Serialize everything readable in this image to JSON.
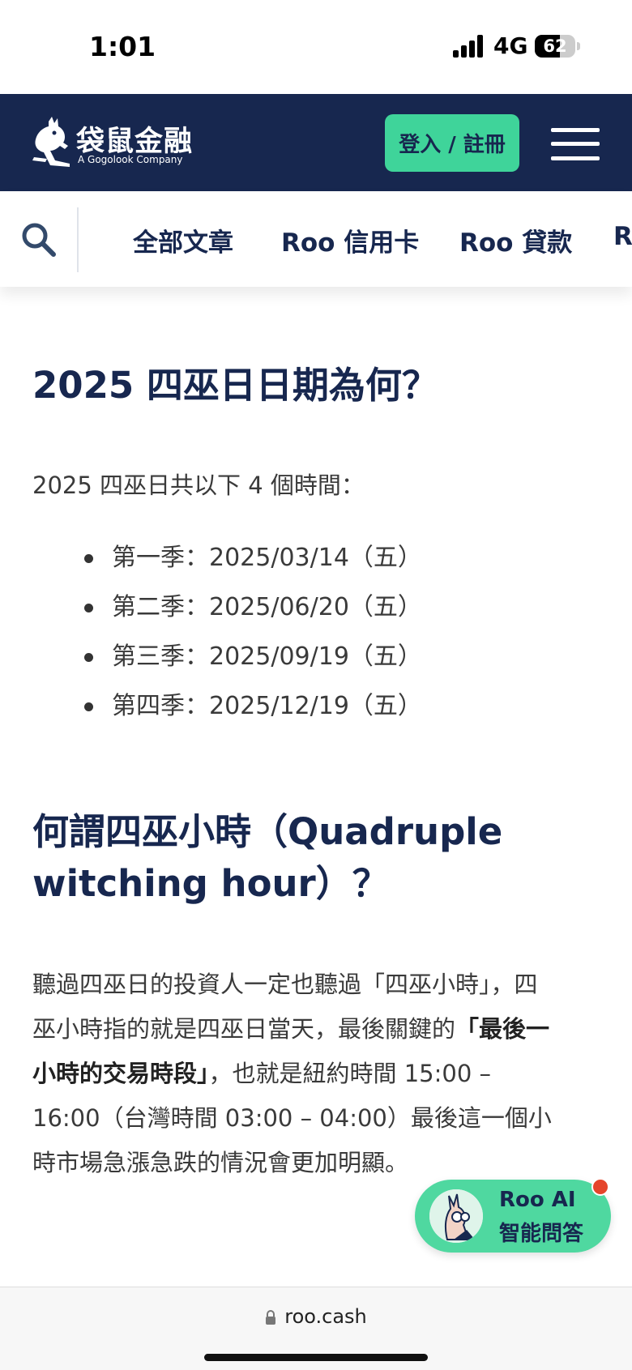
{
  "status_bar": {
    "time": "1:01",
    "network": "4G",
    "battery": "62",
    "battery_level": 0.62
  },
  "header": {
    "logo_name": "袋鼠金融",
    "logo_sub": "A Gogolook Company",
    "login_label": "登入 / 註冊"
  },
  "nav": {
    "items": [
      "全部文章",
      "Roo 信用卡",
      "Roo 貸款",
      "R"
    ]
  },
  "article": {
    "h1": "2025 四巫日日期為何？",
    "intro": "2025 四巫日共以下 4 個時間：",
    "dates": [
      "第一季：2025/03/14（五）",
      "第二季：2025/06/20（五）",
      "第三季：2025/09/19（五）",
      "第四季：2025/12/19（五）"
    ],
    "h2_line1": "何謂四巫小時（Quadruple",
    "h2_line2": "witching hour）？",
    "body": {
      "line1": "聽過四巫日的投資人一定也聽過「四巫小時」，四",
      "line2_a": "巫小時指的就是四巫日當天，最後關鍵的",
      "line2_b": "「最後一",
      "line3_a": "小時的交易時段」",
      "line3_b": "，也就是紐約時間 15:00 –",
      "line4": "16:00（台灣時間 03:00 – 04:00）最後這一個小",
      "line5": "時市場急漲急跌的情況會更加明顯。"
    }
  },
  "ai_button": {
    "line1": "Roo AI",
    "line2": "智能問答"
  },
  "browser": {
    "url": "roo.cash"
  },
  "colors": {
    "navy": "#17274f",
    "green": "#3fd49a",
    "badge_red": "#e5452b"
  }
}
